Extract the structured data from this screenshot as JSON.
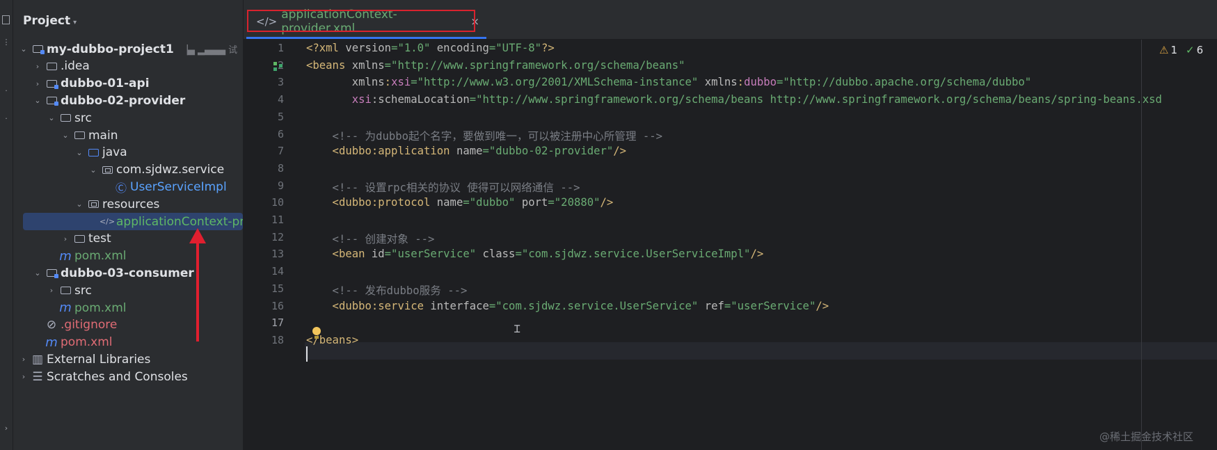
{
  "project_panel": {
    "title": "Project",
    "tree": [
      {
        "label": "my-dubbo-project1",
        "blurred_suffix": "▕▄ ▂▄▄▄ 试",
        "level": 1,
        "expanded": true,
        "icon": "module-folder-icon",
        "bold": true,
        "name": "tree-item-my-dubbo-project1"
      },
      {
        "label": ".idea",
        "level": 2,
        "expanded": false,
        "icon": "folder-icon",
        "name": "tree-item-idea"
      },
      {
        "label": "dubbo-01-api",
        "level": 2,
        "expanded": false,
        "icon": "module-folder-icon",
        "bold": true,
        "name": "tree-item-dubbo-01-api"
      },
      {
        "label": "dubbo-02-provider",
        "level": 2,
        "expanded": true,
        "icon": "module-folder-icon",
        "bold": true,
        "name": "tree-item-dubbo-02-provider"
      },
      {
        "label": "src",
        "level": 3,
        "expanded": true,
        "icon": "folder-icon",
        "name": "tree-item-src"
      },
      {
        "label": "main",
        "level": 4,
        "expanded": true,
        "icon": "folder-icon",
        "name": "tree-item-main"
      },
      {
        "label": "java",
        "level": 5,
        "expanded": true,
        "icon": "source-folder-icon",
        "name": "tree-item-java"
      },
      {
        "label": "com.sjdwz.service",
        "level": 6,
        "expanded": true,
        "icon": "package-icon",
        "name": "tree-item-package"
      },
      {
        "label": "UserServiceImpl",
        "level": 7,
        "icon": "class-icon",
        "color": "java",
        "name": "tree-item-userserviceimpl"
      },
      {
        "label": "resources",
        "level": 5,
        "expanded": true,
        "icon": "resources-folder-icon",
        "name": "tree-item-resources"
      },
      {
        "label": "applicationContext-provider.xml",
        "level": 6,
        "icon": "xml-file-icon",
        "color": "green",
        "selected": true,
        "name": "tree-item-applicationcontext"
      },
      {
        "label": "test",
        "level": 4,
        "expanded": false,
        "icon": "folder-icon",
        "name": "tree-item-test"
      },
      {
        "label": "pom.xml",
        "level": 3,
        "icon": "maven-icon",
        "color": "xml",
        "name": "tree-item-provider-pom"
      },
      {
        "label": "dubbo-03-consumer",
        "level": 2,
        "expanded": true,
        "icon": "module-folder-icon",
        "bold": true,
        "name": "tree-item-dubbo-03-consumer"
      },
      {
        "label": "src",
        "level": 3,
        "expanded": false,
        "icon": "folder-icon",
        "name": "tree-item-consumer-src"
      },
      {
        "label": "pom.xml",
        "level": 3,
        "icon": "maven-icon",
        "color": "xml",
        "name": "tree-item-consumer-pom"
      },
      {
        "label": ".gitignore",
        "level": 2,
        "icon": "ignore-icon",
        "color": "red",
        "name": "tree-item-gitignore"
      },
      {
        "label": "pom.xml",
        "level": 2,
        "icon": "maven-icon",
        "color": "red",
        "name": "tree-item-root-pom"
      },
      {
        "label": "External Libraries",
        "level": 1,
        "expanded": false,
        "icon": "libraries-icon",
        "name": "tree-item-external-libraries"
      },
      {
        "label": "Scratches and Consoles",
        "level": 1,
        "expanded": false,
        "icon": "scratches-icon",
        "name": "tree-item-scratches"
      }
    ]
  },
  "editor": {
    "tab_label": "applicationContext-provider.xml",
    "tab_close": "×",
    "inspections": {
      "warnings": "1",
      "checks": "6"
    },
    "current_line": 17,
    "lines": [
      [
        [
          "p",
          "<?"
        ],
        [
          "t",
          "xml "
        ],
        [
          "a",
          "version"
        ],
        [
          "v",
          "=\"1.0\""
        ],
        [
          "a",
          " encoding"
        ],
        [
          "v",
          "=\"UTF-8\""
        ],
        [
          "p",
          "?>"
        ]
      ],
      [
        [
          "t",
          "<beans "
        ],
        [
          "a",
          "xmlns"
        ],
        [
          "v",
          "=\"http://www.springframework.org/schema/beans\""
        ]
      ],
      [
        [
          "a",
          "       xmlns"
        ],
        [
          "p",
          ":"
        ],
        [
          "ns",
          "xsi"
        ],
        [
          "v",
          "=\"http://www.w3.org/2001/XMLSchema-instance\""
        ],
        [
          "a",
          " xmlns"
        ],
        [
          "p",
          ":"
        ],
        [
          "ns",
          "dubbo"
        ],
        [
          "v",
          "=\"http://dubbo.apache.org/schema/dubbo\""
        ]
      ],
      [
        [
          "ns",
          "       xsi"
        ],
        [
          "a",
          ":schemaLocation"
        ],
        [
          "v",
          "=\"http://www.springframework.org/schema/beans http://www.springframework.org/schema/beans/spring-beans.xsd"
        ]
      ],
      [],
      [
        [
          "c",
          "    <!-- 为dubbo起个名字，要做到唯一，可以被注册中心所管理 -->"
        ]
      ],
      [
        [
          "t",
          "    <dubbo"
        ],
        [
          "p",
          ":"
        ],
        [
          "t",
          "application "
        ],
        [
          "a",
          "name"
        ],
        [
          "v",
          "=\"dubbo-02-provider\""
        ],
        [
          "t",
          "/>"
        ]
      ],
      [],
      [
        [
          "c",
          "    <!-- 设置rpc相关的协议 使得可以网络通信 -->"
        ]
      ],
      [
        [
          "t",
          "    <dubbo"
        ],
        [
          "p",
          ":"
        ],
        [
          "t",
          "protocol "
        ],
        [
          "a",
          "name"
        ],
        [
          "v",
          "=\"dubbo\""
        ],
        [
          "a",
          " port"
        ],
        [
          "v",
          "=\"20880\""
        ],
        [
          "t",
          "/>"
        ]
      ],
      [],
      [
        [
          "c",
          "    <!-- 创建对象 -->"
        ]
      ],
      [
        [
          "t",
          "    <bean "
        ],
        [
          "a",
          "id"
        ],
        [
          "v",
          "=\"userService\""
        ],
        [
          "a",
          " class"
        ],
        [
          "v",
          "=\"com.sjdwz.service.UserServiceImpl\""
        ],
        [
          "t",
          "/>"
        ]
      ],
      [],
      [
        [
          "c",
          "    <!-- 发布dubbo服务 -->"
        ]
      ],
      [
        [
          "t",
          "    <dubbo"
        ],
        [
          "p",
          ":"
        ],
        [
          "t",
          "service "
        ],
        [
          "a",
          "interface"
        ],
        [
          "v",
          "=\"com.sjdwz.service.UserService\""
        ],
        [
          "a",
          " ref"
        ],
        [
          "v",
          "=\"userService\""
        ],
        [
          "t",
          "/>"
        ]
      ],
      [],
      [
        [
          "t",
          "</beans>"
        ]
      ]
    ]
  },
  "watermark": "@稀土掘金技术社区",
  "colors": {
    "annotation_red": "#e01f2f",
    "selection": "#2e436e",
    "accent": "#3574f0"
  }
}
